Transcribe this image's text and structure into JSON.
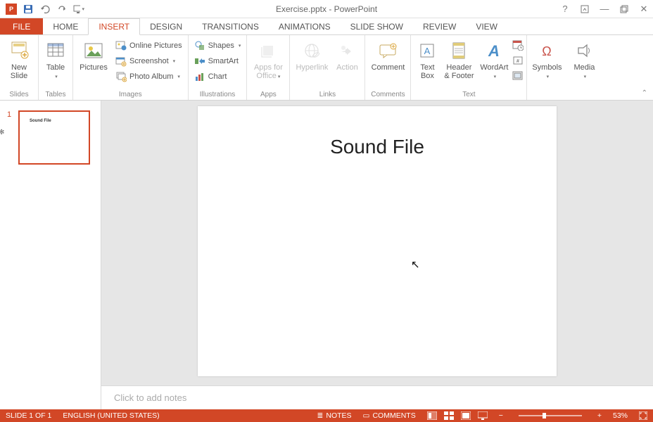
{
  "title": "Exercise.pptx - PowerPoint",
  "tabs": {
    "file": "FILE",
    "home": "HOME",
    "insert": "INSERT",
    "design": "DESIGN",
    "transitions": "TRANSITIONS",
    "animations": "ANIMATIONS",
    "slideshow": "SLIDE SHOW",
    "review": "REVIEW",
    "view": "VIEW"
  },
  "ribbon": {
    "slides": {
      "new_slide": "New\nSlide",
      "label": "Slides"
    },
    "tables": {
      "table": "Table",
      "label": "Tables"
    },
    "images": {
      "pictures": "Pictures",
      "online_pictures": "Online Pictures",
      "screenshot": "Screenshot",
      "photo_album": "Photo Album",
      "label": "Images"
    },
    "illustrations": {
      "shapes": "Shapes",
      "smartart": "SmartArt",
      "chart": "Chart",
      "label": "Illustrations"
    },
    "apps": {
      "apps_for_office": "Apps for\nOffice",
      "label": "Apps"
    },
    "links": {
      "hyperlink": "Hyperlink",
      "action": "Action",
      "label": "Links"
    },
    "comments": {
      "comment": "Comment",
      "label": "Comments"
    },
    "text": {
      "text_box": "Text\nBox",
      "header_footer": "Header\n& Footer",
      "wordart": "WordArt",
      "label": "Text"
    },
    "symbols": {
      "symbols": "Symbols"
    },
    "media": {
      "media": "Media"
    }
  },
  "thumbnail": {
    "number": "1",
    "title": "Sound File"
  },
  "slide": {
    "title": "Sound File"
  },
  "notes_placeholder": "Click to add notes",
  "status": {
    "slide_info": "SLIDE 1 OF 1",
    "language": "ENGLISH (UNITED STATES)",
    "notes": "NOTES",
    "comments": "COMMENTS",
    "zoom": "53%"
  }
}
